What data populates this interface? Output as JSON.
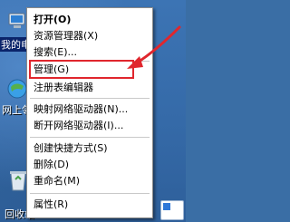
{
  "desktop": {
    "icons": [
      {
        "label": "我的电"
      },
      {
        "label": "网上邻"
      },
      {
        "label": "回收站"
      }
    ]
  },
  "context_menu": {
    "items": [
      {
        "label": "打开(O)"
      },
      {
        "label": "资源管理器(X)"
      },
      {
        "label": "搜索(E)..."
      },
      {
        "label": "管理(G)"
      },
      {
        "label": "注册表编辑器"
      },
      {
        "label": "映射网络驱动器(N)..."
      },
      {
        "label": "断开网络驱动器(I)..."
      },
      {
        "label": "创建快捷方式(S)"
      },
      {
        "label": "删除(D)"
      },
      {
        "label": "重命名(M)"
      },
      {
        "label": "属性(R)"
      }
    ]
  },
  "colors": {
    "highlight_border": "#e0262d",
    "arrow": "#e0262d",
    "desktop": "#3a6ea5"
  }
}
